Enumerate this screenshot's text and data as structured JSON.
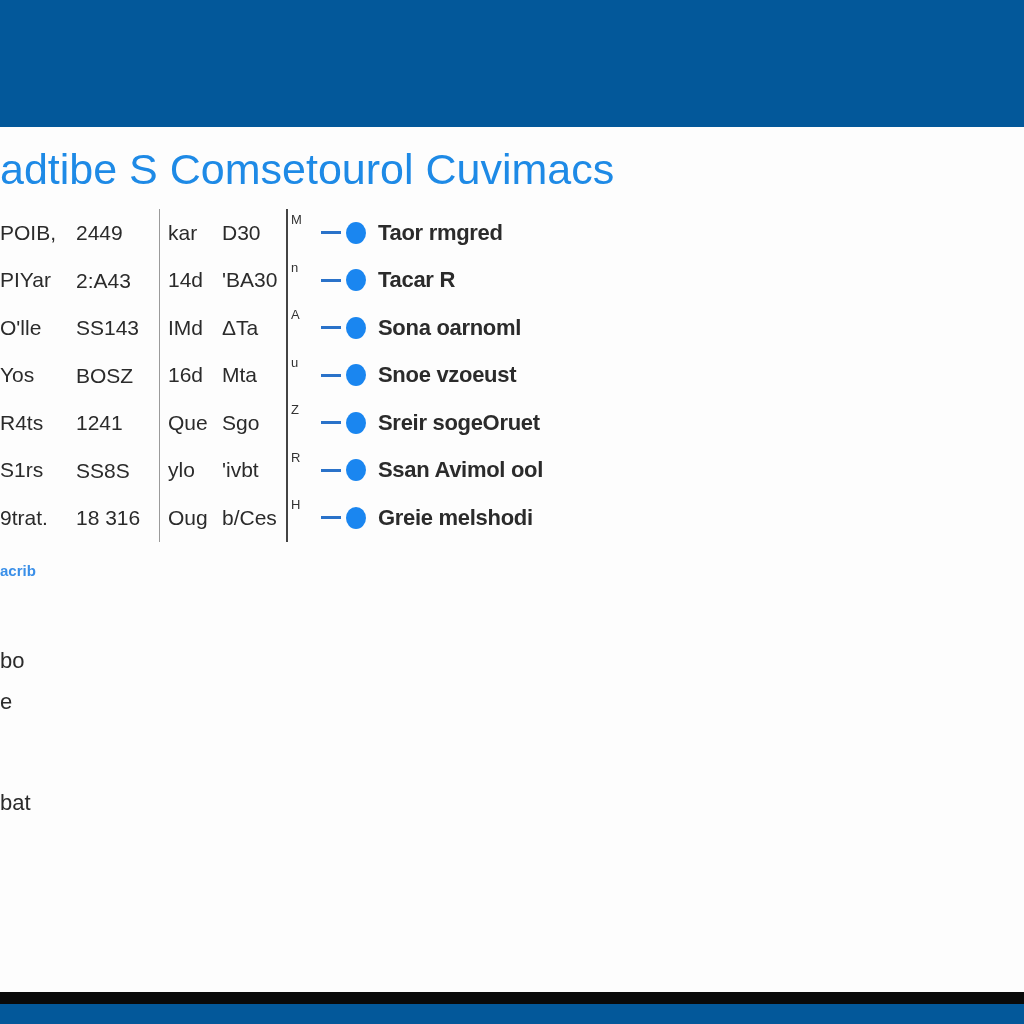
{
  "title": "adtibe S Comsetourol Cuvimacs",
  "rows": [
    {
      "column_1": "POIB,",
      "column_2": "2449",
      "column_3": "kar",
      "column_4": "D30",
      "marker": "M",
      "label": "Taor rmgred"
    },
    {
      "column_1": "PIYar",
      "column_2": "2:A43",
      "column_3": "14d",
      "column_4": "'BA30",
      "marker": "n",
      "label": "Tacar R"
    },
    {
      "column_1": "O'lle",
      "column_2": "SS143",
      "column_3": "IMd",
      "column_4": "ΔTa",
      "marker": "A",
      "label": "Sona oarnoml"
    },
    {
      "column_1": "Yos",
      "column_2": "BOSZ",
      "column_3": "16d",
      "column_4": "Mta",
      "marker": "u",
      "label": "Snoe vzoeust"
    },
    {
      "column_1": "R4ts",
      "column_2": "1241",
      "column_3": "Que",
      "column_4": "Sgo",
      "marker": "Z",
      "label": "Sreir sogeOruet"
    },
    {
      "column_1": "S1rs",
      "column_2": "SS8S",
      "column_3": "ylo",
      "column_4": "'ivbt",
      "marker": "R",
      "label": "Ssan Avimol ool"
    },
    {
      "column_1": "9trat.",
      "column_2": "18 316",
      "column_3": "Oug",
      "column_4": "b/Ces",
      "marker": "H",
      "label": "Greie melshodi"
    }
  ],
  "link": "acrib",
  "list_items": [
    "bo",
    "e",
    "bat"
  ]
}
